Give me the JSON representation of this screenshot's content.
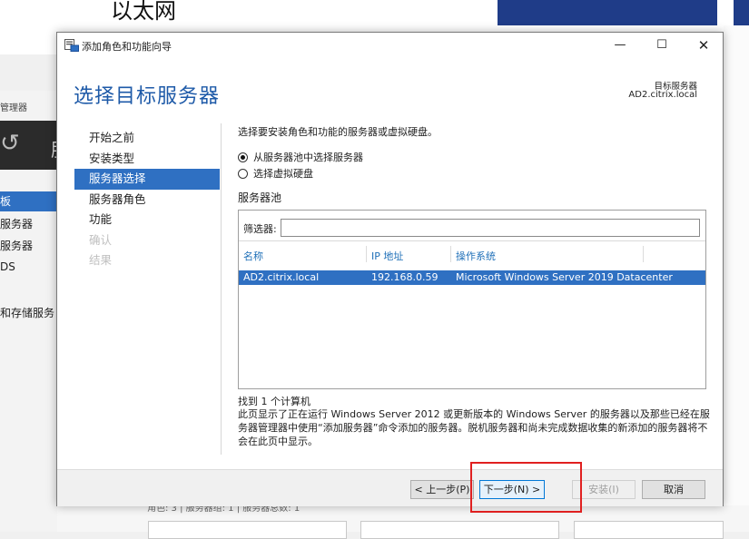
{
  "background": {
    "top_title": "以太网",
    "left_title": "管理器",
    "nav_items": [
      {
        "label": "板",
        "active": true
      },
      {
        "label": "服务器",
        "active": false
      },
      {
        "label": "服务器",
        "active": false
      },
      {
        "label": "DS",
        "active": false
      },
      {
        "label": "和存储服务",
        "active": false
      }
    ],
    "darkbar_text": "服",
    "bottom_text": "角色: 3 | 服务器组: 1 | 服务器总数: 1"
  },
  "window": {
    "title": "添加角色和功能向导",
    "minimize_icon": "minimize-icon",
    "maximize_icon": "maximize-icon",
    "close_icon": "close-icon"
  },
  "header": {
    "page_title": "选择目标服务器",
    "destination_label": "目标服务器",
    "destination_value": "AD2.citrix.local"
  },
  "steps": [
    {
      "label": "开始之前",
      "state": "normal"
    },
    {
      "label": "安装类型",
      "state": "normal"
    },
    {
      "label": "服务器选择",
      "state": "active"
    },
    {
      "label": "服务器角色",
      "state": "normal"
    },
    {
      "label": "功能",
      "state": "normal"
    },
    {
      "label": "确认",
      "state": "disabled"
    },
    {
      "label": "结果",
      "state": "disabled"
    }
  ],
  "content": {
    "intro": "选择要安装角色和功能的服务器或虚拟硬盘。",
    "option_pool": "从服务器池中选择服务器",
    "option_vhd": "选择虚拟硬盘",
    "pool_label": "服务器池",
    "filter_label": "筛选器:",
    "filter_value": "",
    "columns": [
      "名称",
      "IP 地址",
      "操作系统"
    ],
    "rows": [
      {
        "name": "AD2.citrix.local",
        "ip": "192.168.0.59",
        "os": "Microsoft Windows Server 2019 Datacenter"
      }
    ],
    "found": "找到 1 个计算机",
    "note": "此页显示了正在运行 Windows Server 2012 或更新版本的 Windows Server 的服务器以及那些已经在服务器管理器中使用“添加服务器”命令添加的服务器。脱机服务器和尚未完成数据收集的新添加的服务器将不会在此页中显示。"
  },
  "footer": {
    "prev": "< 上一步(P)",
    "next": "下一步(N) >",
    "install": "安装(I)",
    "cancel": "取消"
  },
  "colors": {
    "accent": "#2f70c2",
    "title_blue": "#1e5aa8",
    "highlight": "#e02020"
  }
}
